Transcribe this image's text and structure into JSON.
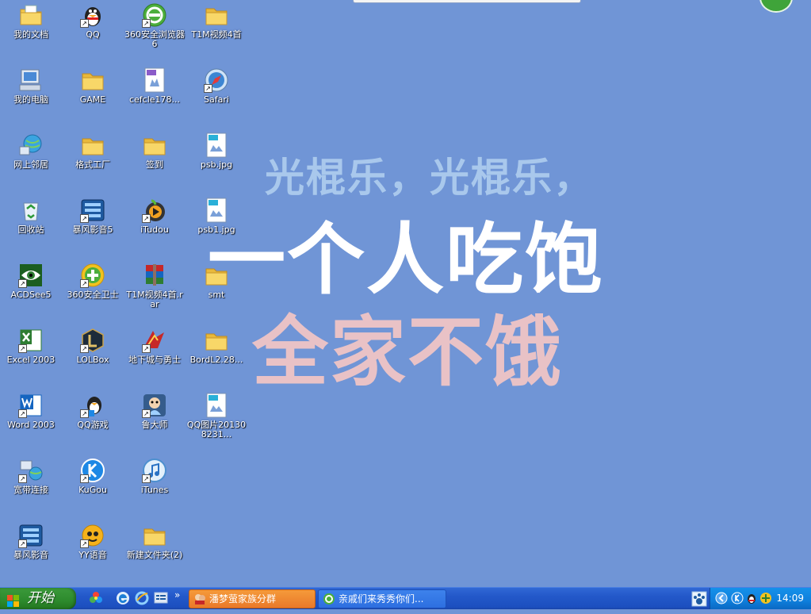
{
  "wallpaper": {
    "line1": "光棍乐，光棍乐，",
    "line2": "一个人吃饱",
    "line3": "全家不饿"
  },
  "desktop_icons": [
    {
      "label": "我的文档",
      "icon": "my-documents-icon"
    },
    {
      "label": "QQ",
      "icon": "qq-penguin-icon",
      "shortcut": true
    },
    {
      "label": "360安全浏览器6",
      "icon": "360-browser-icon",
      "shortcut": true
    },
    {
      "label": "T1M视频4首",
      "icon": "folder-icon"
    },
    {
      "label": "我的电脑",
      "icon": "my-computer-icon"
    },
    {
      "label": "GAME",
      "icon": "folder-icon"
    },
    {
      "label": "cefcle178...",
      "icon": "gif-file-icon"
    },
    {
      "label": "Safari",
      "icon": "safari-compass-icon",
      "shortcut": true
    },
    {
      "label": "网上邻居",
      "icon": "network-places-icon"
    },
    {
      "label": "格式工厂",
      "icon": "folder-icon"
    },
    {
      "label": "签到",
      "icon": "folder-icon"
    },
    {
      "label": "psb.jpg",
      "icon": "jpg-file-icon"
    },
    {
      "label": "回收站",
      "icon": "recycle-bin-icon"
    },
    {
      "label": "暴风影音5",
      "icon": "baofeng-player-icon",
      "shortcut": true
    },
    {
      "label": "iTudou",
      "icon": "itudou-icon",
      "shortcut": true
    },
    {
      "label": "psb1.jpg",
      "icon": "jpg-file-icon"
    },
    {
      "label": "ACDSee5",
      "icon": "acdsee-eye-icon",
      "shortcut": true
    },
    {
      "label": "360安全卫士",
      "icon": "360-safeguard-icon",
      "shortcut": true
    },
    {
      "label": "T1M视频4首.rar",
      "icon": "winrar-archive-icon"
    },
    {
      "label": "smt",
      "icon": "folder-icon"
    },
    {
      "label": "Excel 2003",
      "icon": "excel-icon",
      "shortcut": true
    },
    {
      "label": "LOLBox",
      "icon": "lolbox-icon",
      "shortcut": true
    },
    {
      "label": "地下城与勇士",
      "icon": "dnf-game-icon",
      "shortcut": true
    },
    {
      "label": "BordL2.28...",
      "icon": "folder-icon"
    },
    {
      "label": "Word 2003",
      "icon": "word-icon",
      "shortcut": true
    },
    {
      "label": "QQ游戏",
      "icon": "qq-game-icon",
      "shortcut": true
    },
    {
      "label": "鲁大师",
      "icon": "ludashi-icon",
      "shortcut": true
    },
    {
      "label": "QQ图片201308231...",
      "icon": "jpg-file-icon"
    },
    {
      "label": "宽带连接",
      "icon": "broadband-connection-icon",
      "shortcut": true
    },
    {
      "label": "KuGou",
      "icon": "kugou-icon",
      "shortcut": true
    },
    {
      "label": "iTunes",
      "icon": "itunes-icon",
      "shortcut": true
    },
    {
      "label": "暴风影音",
      "icon": "baofeng-player-icon",
      "shortcut": true
    },
    {
      "label": "YY语音",
      "icon": "yy-voice-icon",
      "shortcut": true
    },
    {
      "label": "新建文件夹(2)",
      "icon": "folder-icon"
    }
  ],
  "taskbar": {
    "start_label": "开始",
    "tasks": [
      {
        "label": "潘梦萤家族分群",
        "icon": "qq-group-icon",
        "active": true
      },
      {
        "label": "亲戚们来秀秀你们...",
        "icon": "360-browser-icon",
        "active": false
      }
    ],
    "clock": "14:09",
    "quicklaunch_more": "»"
  },
  "colors": {
    "desktop": "#7095d6",
    "taskbar": "#2358c9",
    "start_button": "#2d8a2d",
    "active_task": "#e9792a"
  }
}
